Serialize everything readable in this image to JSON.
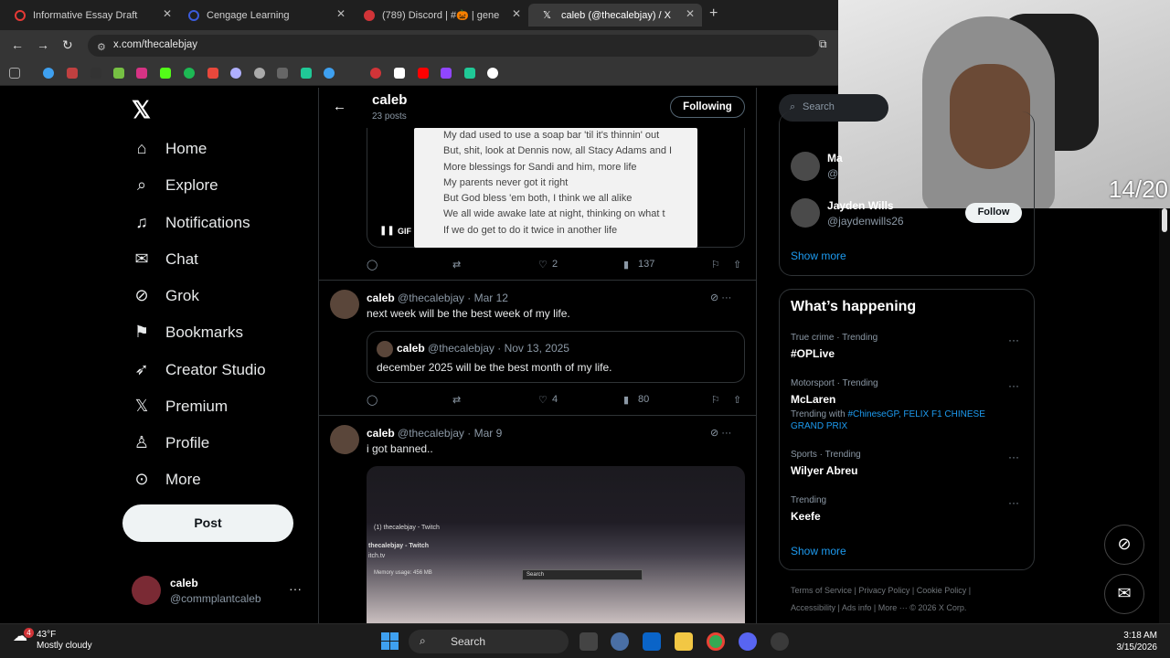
{
  "browser": {
    "tabs": [
      {
        "title": "Informative Essay Draft",
        "icon": "google-docs-icon",
        "icon_color": "#e53935"
      },
      {
        "title": "Cengage Learning",
        "icon": "cengage-icon",
        "icon_color": "#3b5bdb"
      },
      {
        "title": "(789) Discord | #🎃 | gene",
        "icon": "discord-icon",
        "icon_color": "#d13438"
      },
      {
        "title": "caleb (@thecalebjay) / X",
        "icon": "x-icon",
        "icon_color": "#ffffff"
      }
    ],
    "url": "x.com/thecalebjay"
  },
  "overlay": {
    "counter": "14/20"
  },
  "nav": {
    "items": [
      {
        "label": "Home",
        "icon": "home-icon"
      },
      {
        "label": "Explore",
        "icon": "search-icon"
      },
      {
        "label": "Notifications",
        "icon": "bell-icon"
      },
      {
        "label": "Chat",
        "icon": "mail-icon"
      },
      {
        "label": "Grok",
        "icon": "grok-icon"
      },
      {
        "label": "Bookmarks",
        "icon": "bookmark-icon"
      },
      {
        "label": "Creator Studio",
        "icon": "rocket-icon"
      },
      {
        "label": "Premium",
        "icon": "x-icon"
      },
      {
        "label": "Profile",
        "icon": "person-icon"
      },
      {
        "label": "More",
        "icon": "more-circle-icon"
      }
    ],
    "post_label": "Post",
    "account": {
      "name": "caleb",
      "handle": "@commplantcaleb"
    }
  },
  "profile_header": {
    "name": "caleb",
    "posts": "23 posts",
    "following_label": "Following"
  },
  "tweets": {
    "t0": {
      "lyrics": [
        "My dad used to use a soap bar 'til it's thinnin' out",
        "But, shit, look at Dennis now, all Stacy Adams and I",
        "More blessings for Sandi and him, more life",
        "My parents never got it right",
        "But God bless 'em both, I think we all alike",
        "We all wide awake late at night, thinking on what t",
        "If we do get to do it twice in another life"
      ],
      "gif_label": "GIF",
      "likes": "2",
      "views": "137"
    },
    "t1": {
      "name": "caleb",
      "meta": "@thecalebjay · Mar 12",
      "text": "next week will be the best week of my life.",
      "quote": {
        "name": "caleb",
        "meta": "@thecalebjay · Nov 13, 2025",
        "text": "december 2025 will be the best month of my life."
      },
      "likes": "4",
      "views": "80"
    },
    "t2": {
      "name": "caleb",
      "meta": "@thecalebjay · Mar 9",
      "text": "i got banned..",
      "video": {
        "tab": "(1) thecalebjay - Twitch",
        "popup_title": "thecalebjay - Twitch",
        "popup_url": "itch.tv",
        "memory": "Memory usage: 456 MB",
        "search": "Search"
      }
    }
  },
  "sidebar": {
    "search_placeholder": "Search",
    "who_to_follow": [
      {
        "name": "Ma",
        "handle": "@"
      },
      {
        "name": "Jayden Wills",
        "handle": "@jaydenwills26"
      }
    ],
    "follow_label": "Follow",
    "show_more": "Show more",
    "happening": {
      "title": "What’s happening",
      "trends": [
        {
          "meta": "True crime · Trending",
          "name": "#OPLive"
        },
        {
          "meta": "Motorsport · Trending",
          "name": "McLaren",
          "extra_prefix": "Trending with",
          "extra_link": "#ChineseGP, FELIX F1 CHINESE GRAND PRIX"
        },
        {
          "meta": "Sports · Trending",
          "name": "Wilyer Abreu"
        },
        {
          "meta": "Trending",
          "name": "Keefe"
        }
      ],
      "show_more": "Show more"
    },
    "footer": {
      "line1": [
        "Terms of Service",
        "Privacy Policy",
        "Cookie Policy"
      ],
      "line2": [
        "Accessibility",
        "Ads info",
        "More ···",
        "© 2026 X Corp."
      ]
    }
  },
  "taskbar": {
    "temp": "43°F",
    "condition": "Mostly cloudy",
    "weather_badge": "4",
    "search": "Search",
    "time": "3:18 AM",
    "date": "3/15/2026"
  }
}
